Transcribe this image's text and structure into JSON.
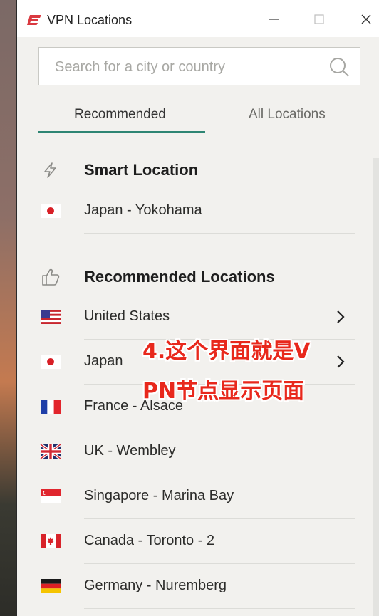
{
  "window": {
    "title": "VPN Locations",
    "controls": {
      "minimize": "—",
      "maximize": "☐",
      "close": "✕"
    }
  },
  "search": {
    "placeholder": "Search for a city or country",
    "value": ""
  },
  "tabs": [
    {
      "label": "Recommended",
      "active": true
    },
    {
      "label": "All Locations",
      "active": false
    }
  ],
  "smart_location": {
    "heading": "Smart Location",
    "icon": "lightning-icon",
    "item": {
      "label": "Japan - Yokohama",
      "flag": "japan-flag-icon"
    }
  },
  "recommended": {
    "heading": "Recommended Locations",
    "icon": "thumbs-up-icon",
    "items": [
      {
        "label": "United States",
        "flag": "us-flag-icon",
        "expandable": true
      },
      {
        "label": "Japan",
        "flag": "japan-flag-icon",
        "expandable": true
      },
      {
        "label": "France - Alsace",
        "flag": "france-flag-icon",
        "expandable": false
      },
      {
        "label": "UK - Wembley",
        "flag": "uk-flag-icon",
        "expandable": false
      },
      {
        "label": "Singapore - Marina Bay",
        "flag": "singapore-flag-icon",
        "expandable": false
      },
      {
        "label": "Canada - Toronto - 2",
        "flag": "canada-flag-icon",
        "expandable": false
      },
      {
        "label": "Germany - Nuremberg",
        "flag": "germany-flag-icon",
        "expandable": false
      }
    ]
  },
  "annotation": {
    "line1": "4.这个界面就是V",
    "line2": "PN节点显示页面",
    "color": "#e8281c"
  },
  "colors": {
    "accent": "#2e8573",
    "brand": "#da3940"
  }
}
